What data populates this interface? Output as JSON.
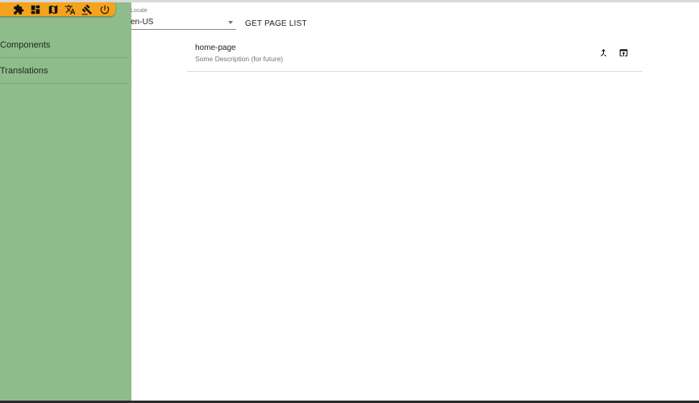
{
  "toolbar": {
    "background": "#f5a31c",
    "icons": [
      "puzzle-icon",
      "dashboard-icon",
      "map-icon",
      "translate-icon",
      "gavel-icon",
      "power-icon"
    ]
  },
  "sidebar": {
    "background": "#8fbc8b",
    "items": [
      {
        "label": "Components"
      },
      {
        "label": "Translations"
      }
    ]
  },
  "locale": {
    "label": "Locale",
    "value": "en-US"
  },
  "actions": {
    "get_page_list": "GET PAGE LIST"
  },
  "pages": [
    {
      "title": "home-page",
      "description": "Some Description (for future)",
      "action_icons": [
        "merge-icon",
        "open-in-new-icon"
      ]
    }
  ]
}
